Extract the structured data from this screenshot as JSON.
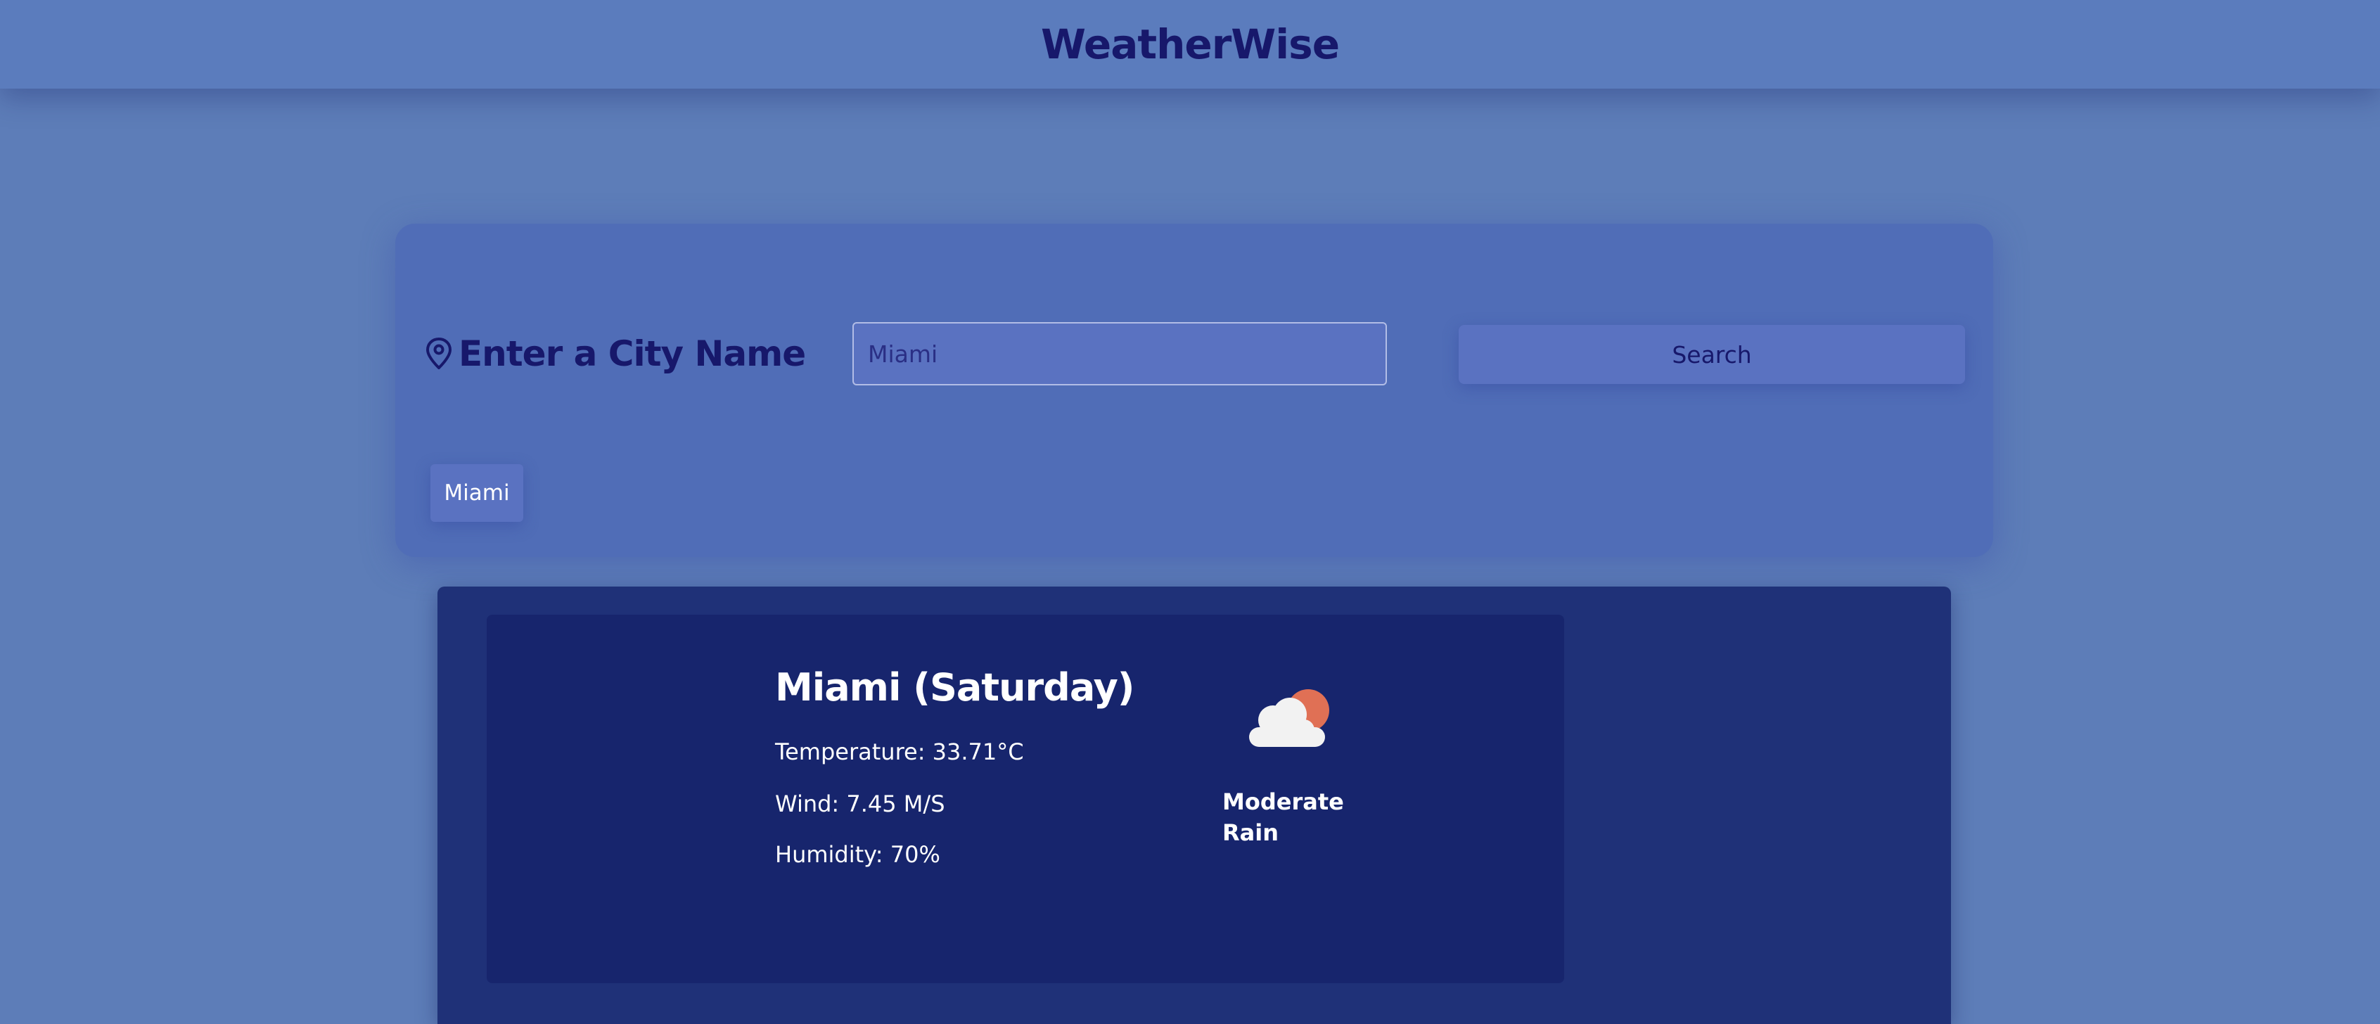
{
  "app": {
    "title": "WeatherWise"
  },
  "search": {
    "label": "Enter a City Name",
    "label_icon": "map-pin-icon",
    "input_value": "Miami",
    "input_placeholder": "",
    "button_label": "Search",
    "history": [
      {
        "label": "Miami"
      }
    ]
  },
  "current": {
    "city_day": "Miami (Saturday)",
    "temperature": "Temperature: 33.71°C",
    "wind": "Wind: 7.45 M/S",
    "humidity": "Humidity: 70%",
    "condition": "Moderate Rain",
    "icon": "cloud-sun-icon"
  },
  "colors": {
    "page_background": "#5d7db8",
    "header_background": "#5b7cbd",
    "title_text": "#17186b",
    "search_card": "#506db7",
    "results_panel": "#1f3178",
    "weather_card": "#17256d",
    "sun": "#e07055",
    "cloud": "#f2f2f2"
  }
}
